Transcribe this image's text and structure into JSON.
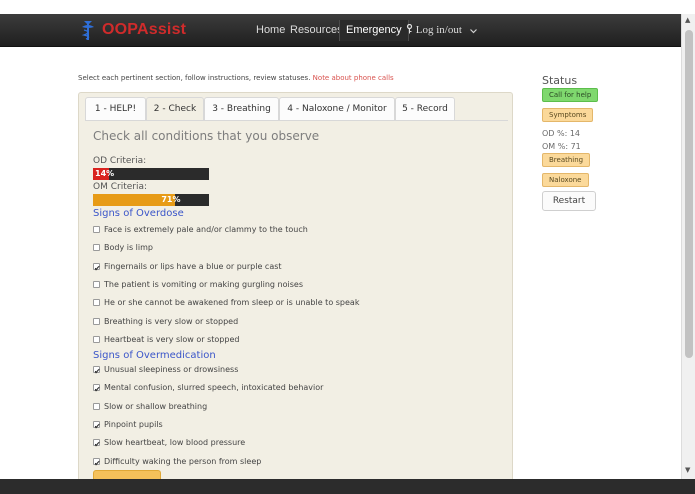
{
  "app": {
    "logo_text": "OOPAssist"
  },
  "nav": {
    "home": "Home",
    "resources": "Resources",
    "emergency": "Emergency",
    "login": "Log in/out"
  },
  "instruction": {
    "text": "Select each pertinent section, follow instructions, review statuses.",
    "note": "Note about phone calls"
  },
  "tabs": [
    {
      "label": "1 - HELP!"
    },
    {
      "label": "2 - Check"
    },
    {
      "label": "3 - Breathing"
    },
    {
      "label": "4 - Naloxone / Monitor"
    },
    {
      "label": "5 - Record"
    }
  ],
  "active_tab": 1,
  "panel": {
    "heading": "Check all conditions that you observe",
    "od_label": "OD Criteria:",
    "od_percent": 14,
    "od_text": "14%",
    "om_label": "OM Criteria:",
    "om_percent": 71,
    "om_text": "71%"
  },
  "overdose": {
    "title": "Signs of Overdose",
    "items": [
      {
        "label": "Face is extremely pale and/or clammy to the touch",
        "checked": false
      },
      {
        "label": "Body is limp",
        "checked": false
      },
      {
        "label": "Fingernails or lips have a blue or purple cast",
        "checked": true
      },
      {
        "label": "The patient is vomiting or making gurgling noises",
        "checked": false
      },
      {
        "label": "He or she cannot be awakened from sleep or is unable to speak",
        "checked": false
      },
      {
        "label": "Breathing is very slow or stopped",
        "checked": false
      },
      {
        "label": "Heartbeat is very slow or stopped",
        "checked": false
      }
    ]
  },
  "overmedication": {
    "title": "Signs of Overmedication",
    "items": [
      {
        "label": "Unusual sleepiness or drowsiness",
        "checked": true
      },
      {
        "label": "Mental confusion, slurred speech, intoxicated behavior",
        "checked": true
      },
      {
        "label": "Slow or shallow breathing",
        "checked": false
      },
      {
        "label": "Pinpoint pupils",
        "checked": true
      },
      {
        "label": "Slow heartbeat, low blood pressure",
        "checked": true
      },
      {
        "label": "Difficulty waking the person from sleep",
        "checked": true
      }
    ]
  },
  "status": {
    "title": "Status",
    "call_for_help": "Call for help",
    "symptoms": "Symptoms",
    "od_line": "OD %: 14",
    "om_line": "OM %: 71",
    "breathing": "Breathing",
    "naloxone": "Naloxone",
    "restart": "Restart"
  },
  "colors": {
    "od_bar": "#d9231f",
    "om_bar": "#e79b17",
    "green_badge": "#7fd86e",
    "orange_badge": "#fbd99a"
  }
}
